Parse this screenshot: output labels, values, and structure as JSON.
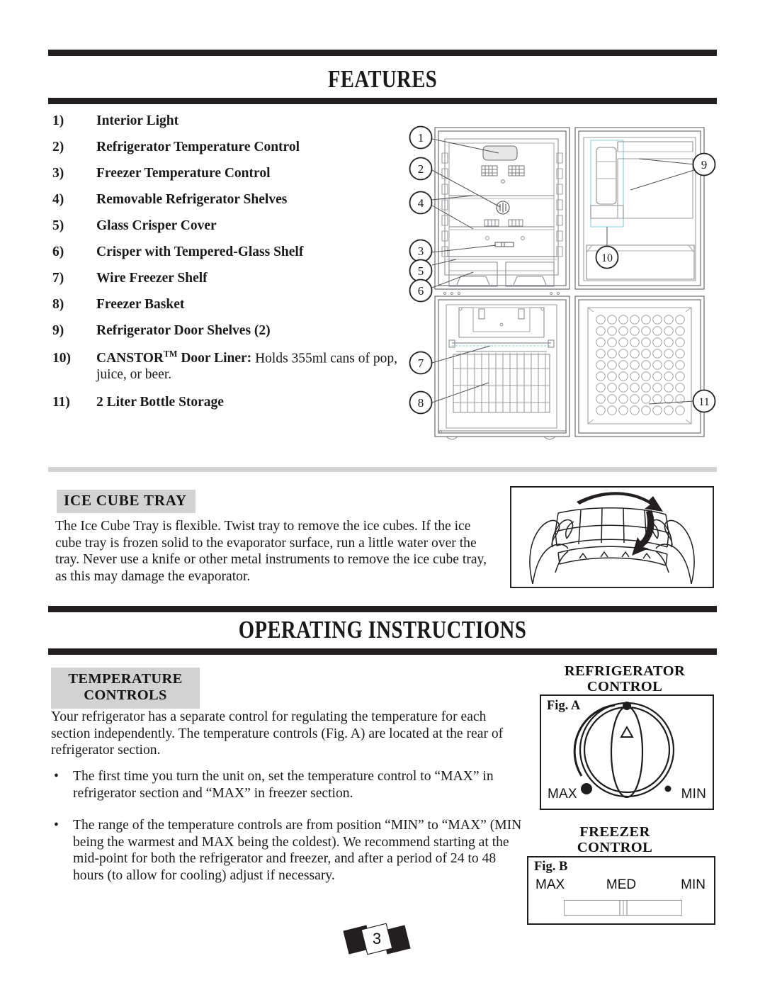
{
  "sections": {
    "features": {
      "title": "FEATURES",
      "items": [
        {
          "num": "1)",
          "label": "Interior Light",
          "extra": ""
        },
        {
          "num": "2)",
          "label": "Refrigerator Temperature Control",
          "extra": ""
        },
        {
          "num": "3)",
          "label": "Freezer Temperature Control",
          "extra": ""
        },
        {
          "num": "4)",
          "label": "Removable Refrigerator Shelves",
          "extra": ""
        },
        {
          "num": "5)",
          "label": "Glass Crisper Cover",
          "extra": ""
        },
        {
          "num": "6)",
          "label": "Crisper with Tempered-Glass Shelf",
          "extra": ""
        },
        {
          "num": "7)",
          "label": "Wire Freezer Shelf",
          "extra": ""
        },
        {
          "num": "8)",
          "label": "Freezer Basket",
          "extra": ""
        },
        {
          "num": "9)",
          "label": "Refrigerator Door Shelves (2)",
          "extra": ""
        },
        {
          "num": "10)",
          "label": "CANSTOR",
          "label_tm": "TM",
          "label_rest": " Door Liner:",
          "extra": " Holds 355ml cans of pop, juice, or beer."
        },
        {
          "num": "11)",
          "label": "2 Liter Bottle Storage",
          "extra": ""
        }
      ]
    },
    "ice_cube_tray": {
      "heading": "ICE CUBE TRAY",
      "paragraph": "The Ice Cube Tray is flexible. Twist tray to remove the ice cubes. If the ice cube tray is frozen solid to the evaporator surface, run a little water over the tray. Never use a knife or other metal instruments to remove the ice cube tray, as this may damage the evaporator."
    },
    "operating": {
      "title": "OPERATING INSTRUCTIONS",
      "temperature_controls": {
        "heading_line1": "TEMPERATURE",
        "heading_line2": "CONTROLS",
        "paragraph": "Your refrigerator has a separate control for regulating the temperature for each section independently. The temperature controls (Fig. A) are located at the rear of refrigerator section.",
        "bullets": [
          {
            "marker": "•",
            "text": "The first time you turn the unit on, set the temperature control to “MAX” in refrigerator section and “MAX” in freezer section."
          },
          {
            "marker": "•",
            "text": "The range of the temperature controls are from position “MIN” to “MAX” (MIN being the warmest and MAX being the coldest). We recommend starting at the mid-point for both the refrigerator and freezer, and after a period of 24 to 48 hours (to allow for cooling) adjust if necessary."
          }
        ]
      },
      "refrigerator_control": {
        "heading_line1": "REFRIGERATOR",
        "heading_line2": "CONTROL",
        "fig_label": "Fig. A",
        "max_label": "MAX",
        "min_label": "MIN"
      },
      "freezer_control": {
        "heading_line1": "FREEZER",
        "heading_line2": "CONTROL",
        "fig_label": "Fig. B",
        "max_label": "MAX",
        "med_label": "MED",
        "min_label": "MIN"
      }
    }
  },
  "diagram": {
    "callouts": [
      "1",
      "2",
      "4",
      "3",
      "5",
      "6",
      "7",
      "8",
      "9",
      "10",
      "11"
    ]
  },
  "footer": {
    "page_number": "3"
  },
  "colors": {
    "rule_dark": "#231f20",
    "rule_light": "#d2d3d5",
    "gray_box": "#d2d2d2",
    "text": "#1a1a1a"
  }
}
